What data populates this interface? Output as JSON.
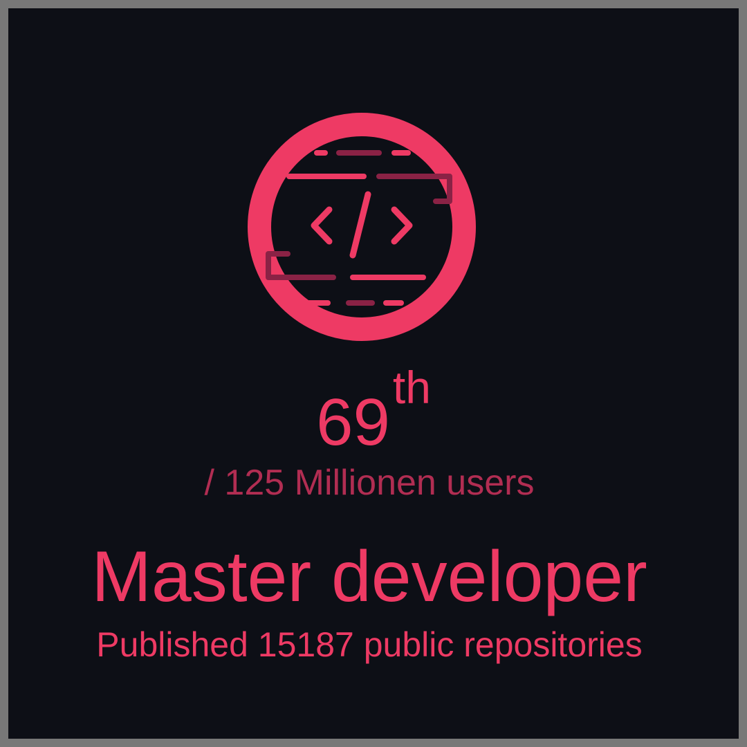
{
  "colors": {
    "background": "#0d0f16",
    "border": "#787878",
    "accent": "#ee3a64",
    "accent_dim": "#b12d52",
    "accent_dark": "#8a2245"
  },
  "badge": {
    "icon": "code-brackets-icon"
  },
  "rank": {
    "number": "69",
    "suffix": "th"
  },
  "total_users": "/ 125 Millionen users",
  "title": "Master developer",
  "subtitle": "Published 15187 public repositories"
}
